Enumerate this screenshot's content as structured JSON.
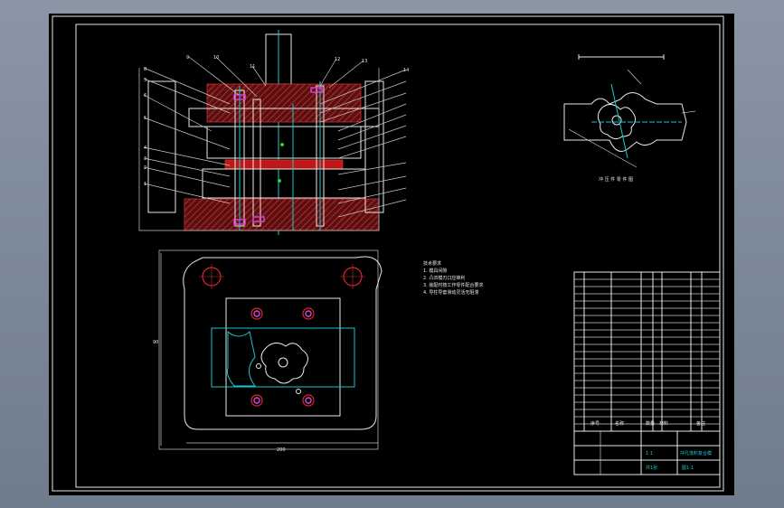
{
  "drawing": {
    "dimension_width": "200",
    "dimension_height": "90",
    "part_caption": "冲 压 件 零 件 图",
    "notes_heading": "技术要求",
    "notes": [
      "1. 模具间隙",
      "2. 凸凹模刃口应锋利",
      "3. 装配时按工作零件配合要求",
      "4. 导柱导套滑动灵活无阻滞"
    ],
    "title_block": {
      "drawing_title": "冲孔落料复合模",
      "drawing_no": "图1-1",
      "scale": "1:1",
      "sheet": "共1张"
    },
    "bom_header": [
      "序号",
      "名称",
      "数量",
      "材料",
      "备注"
    ],
    "part_numbers_left": [
      "8",
      "3",
      "6",
      "5",
      "4",
      "3",
      "2",
      "1"
    ],
    "part_numbers_top": [
      "9",
      "10",
      "11",
      "12",
      "13",
      "14"
    ]
  }
}
